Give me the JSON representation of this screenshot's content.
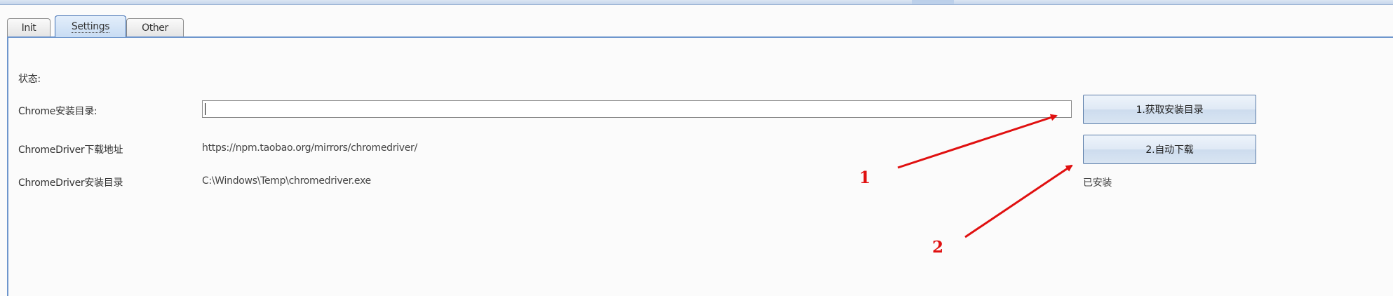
{
  "tabs": [
    {
      "label": "Init",
      "active": false
    },
    {
      "label": "Settings",
      "active": true
    },
    {
      "label": "Other",
      "active": false
    }
  ],
  "form": {
    "status_label": "状态:",
    "chrome_dir_label": "Chrome安装目录:",
    "chrome_dir_value": "",
    "driver_url_label": "ChromeDriver下载地址",
    "driver_url_value": "https://npm.taobao.org/mirrors/chromedriver/",
    "driver_dir_label": "ChromeDriver安装目录",
    "driver_dir_value": "C:\\Windows\\Temp\\chromedriver.exe",
    "installed_status": "已安装"
  },
  "buttons": {
    "get_dir": "1.获取安装目录",
    "auto_download": "2.自动下载"
  },
  "annotations": {
    "marker_1": "1",
    "marker_2": "2",
    "color": "#e01010"
  },
  "colors": {
    "accent": "#6e96cd",
    "annotation": "#e01010"
  }
}
